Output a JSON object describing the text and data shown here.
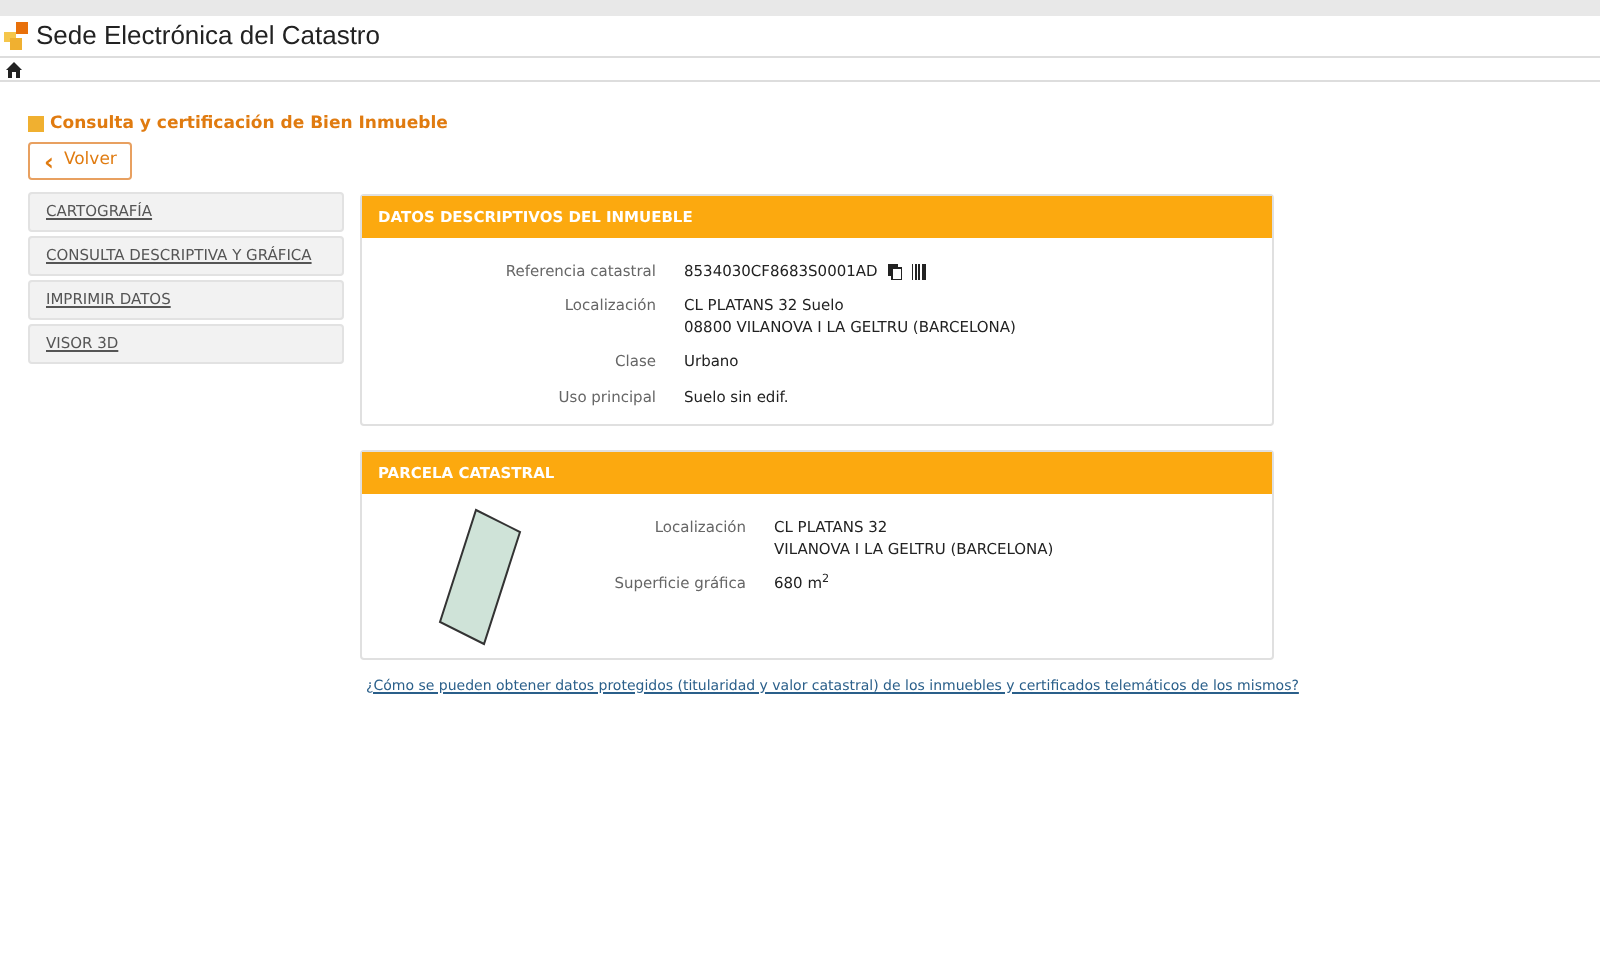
{
  "header": {
    "title": "Sede Electrónica del Catastro"
  },
  "page_title": "Consulta y certificación de Bien Inmueble",
  "back_button": {
    "icon": "‹",
    "label": "Volver"
  },
  "sidebar": {
    "items": [
      "CARTOGRAFÍA",
      "CONSULTA DESCRIPTIVA Y GRÁFICA",
      "IMPRIMIR DATOS",
      "VISOR 3D"
    ]
  },
  "panels": [
    {
      "kind": "details",
      "title": "DATOS DESCRIPTIVOS DEL INMUEBLE",
      "rows": [
        {
          "label": "Referencia catastral",
          "lines": [
            "8534030CF8683S0001AD"
          ],
          "icons": true
        },
        {
          "label": "Localización",
          "lines": [
            "CL PLATANS 32 Suelo",
            "08800 VILANOVA I LA GELTRU (BARCELONA)"
          ]
        },
        {
          "label": "Clase",
          "lines": [
            "Urbano"
          ]
        },
        {
          "label": "Uso principal",
          "lines": [
            "Suelo sin edif."
          ]
        }
      ]
    },
    {
      "kind": "parcel",
      "title": "PARCELA CATASTRAL",
      "rows": [
        {
          "label": "Localización",
          "lines": [
            "CL PLATANS 32",
            "VILANOVA I LA GELTRU (BARCELONA)"
          ]
        },
        {
          "label": "Superficie gráfica",
          "lines": [
            "680 m$^{2}$"
          ]
        }
      ]
    }
  ],
  "help_link": "¿Cómo se pueden obtener datos protegidos (titularidad y valor catastral) de los inmuebles y certificados telemáticos de los mismos?"
}
